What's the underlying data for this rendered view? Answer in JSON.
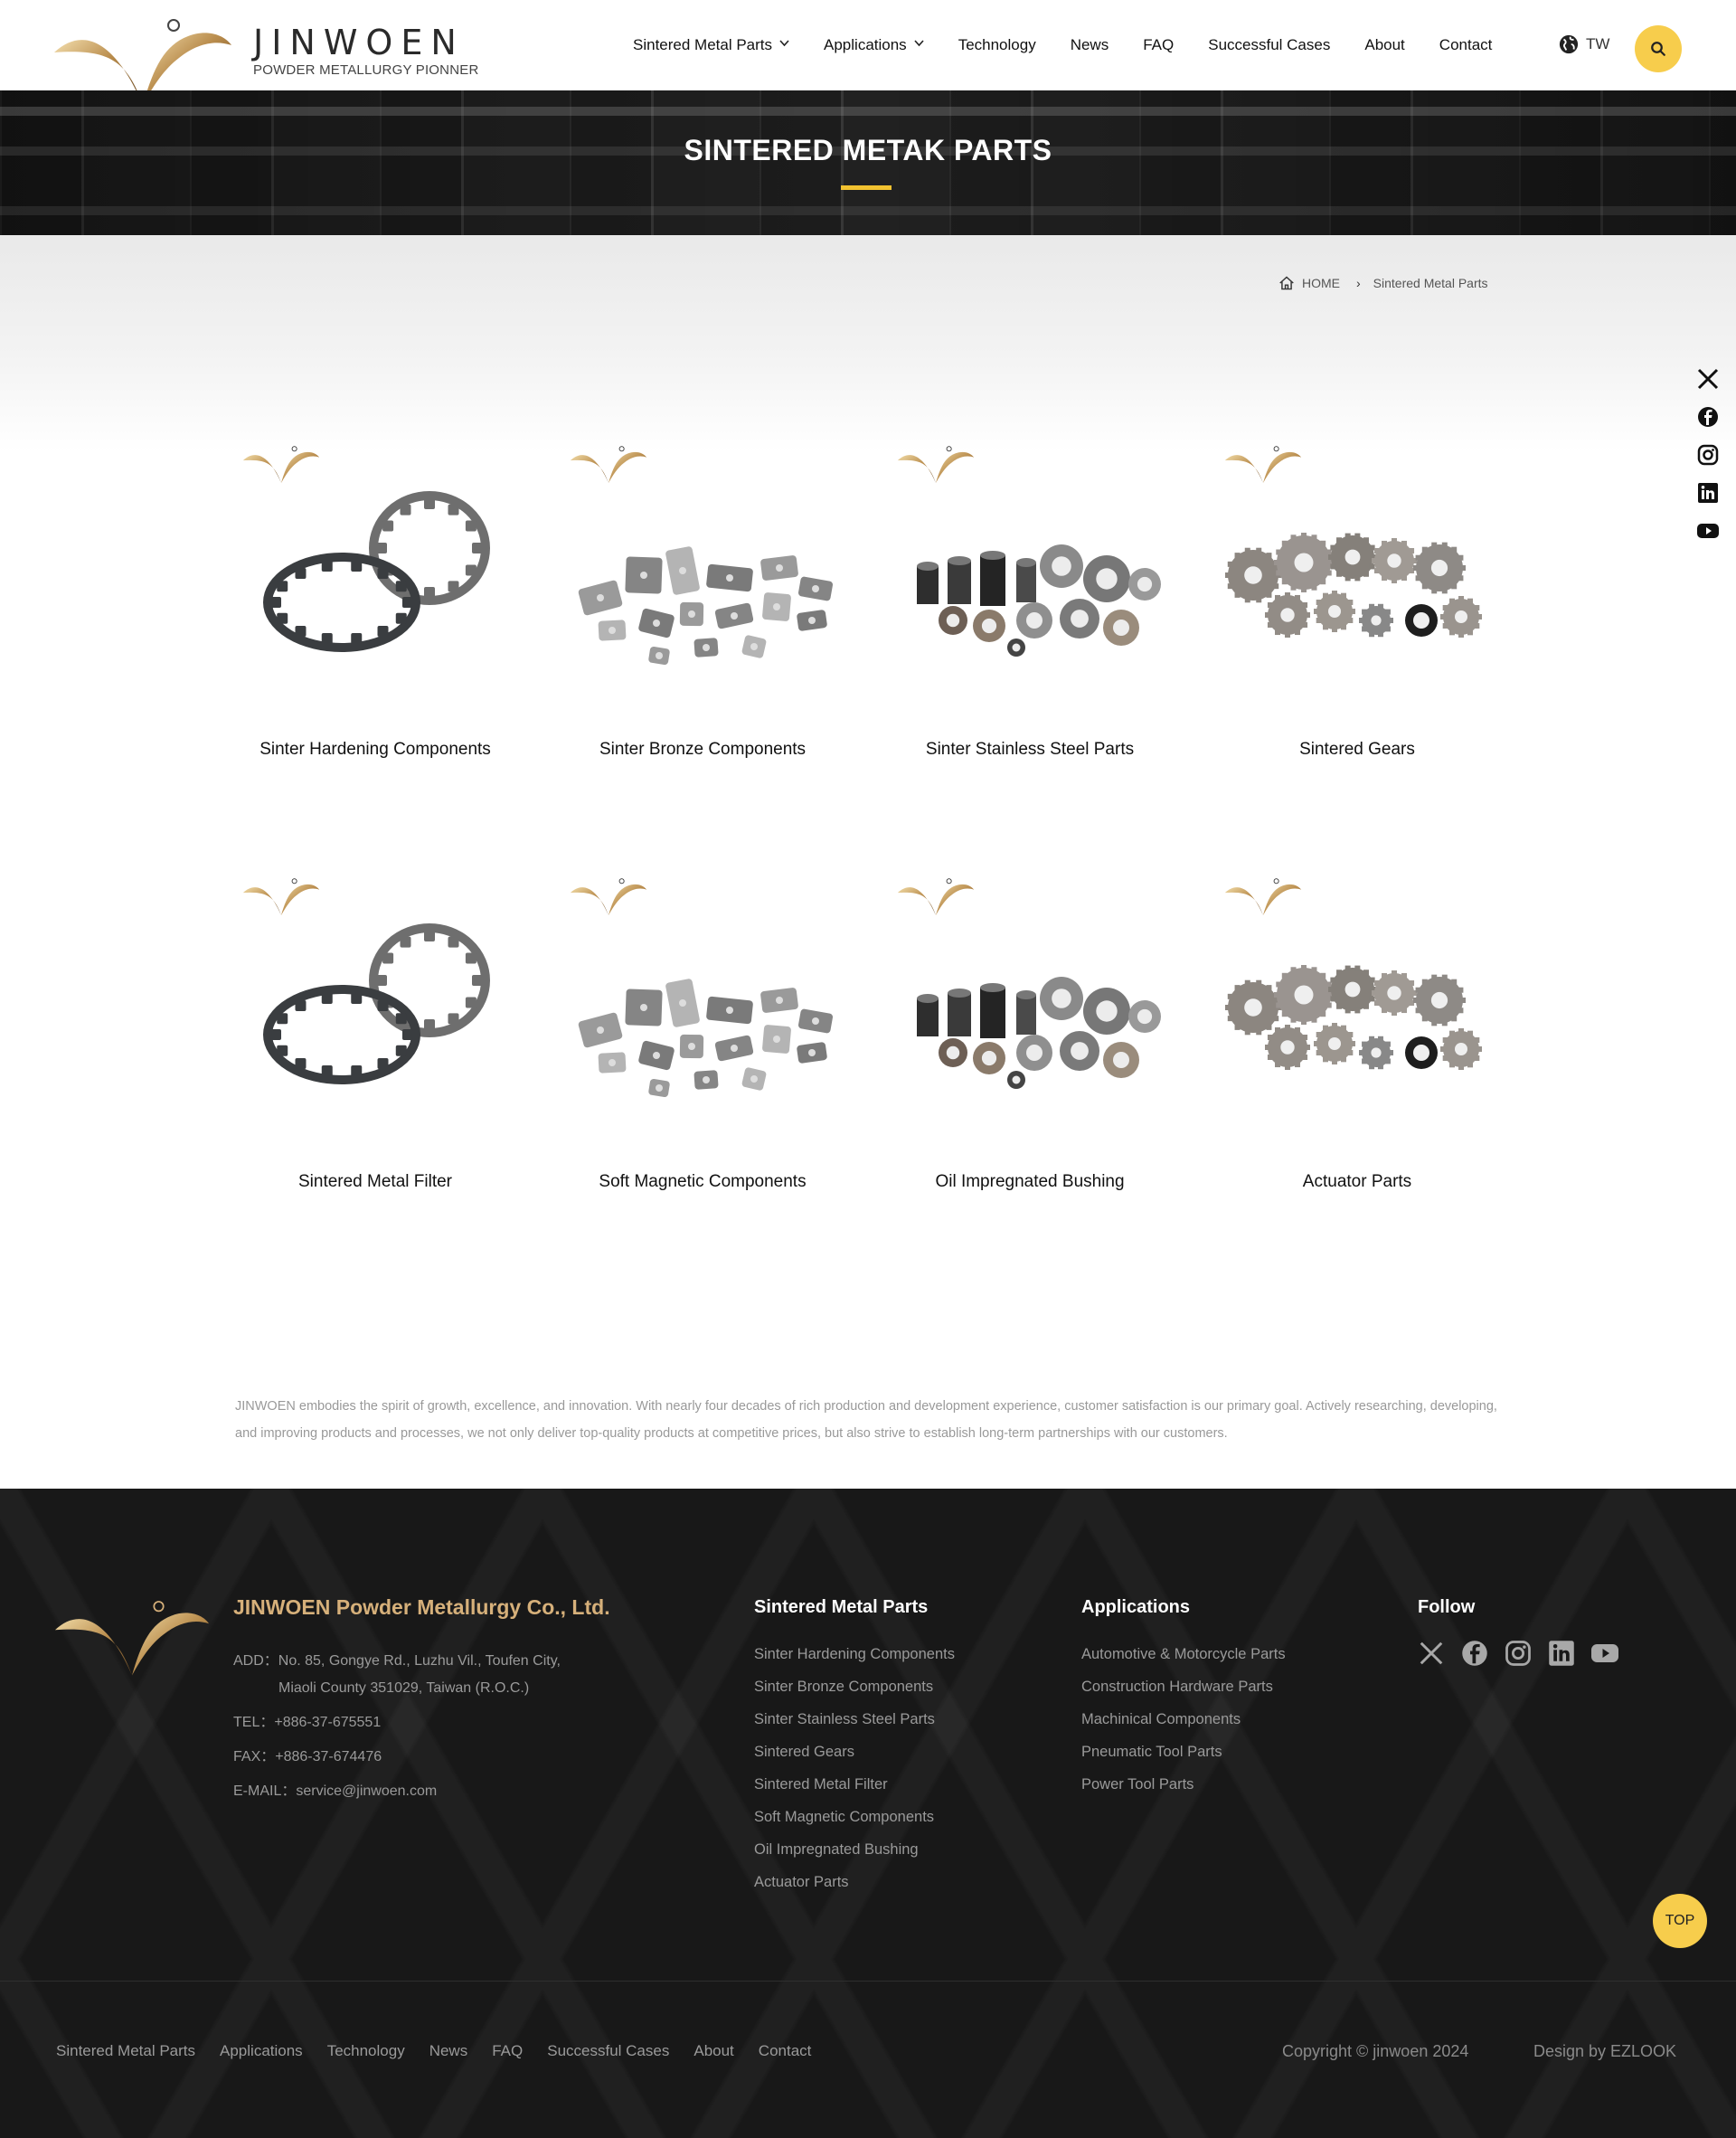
{
  "header": {
    "logo_name": "JINWOEN",
    "logo_sub": "POWDER METALLURGY PIONNER",
    "nav": [
      {
        "label": "Sintered Metal Parts",
        "dropdown": true
      },
      {
        "label": "Applications",
        "dropdown": true
      },
      {
        "label": "Technology",
        "dropdown": false
      },
      {
        "label": "News",
        "dropdown": false
      },
      {
        "label": "FAQ",
        "dropdown": false
      },
      {
        "label": "Successful Cases",
        "dropdown": false
      },
      {
        "label": "About",
        "dropdown": false
      },
      {
        "label": "Contact",
        "dropdown": false
      }
    ],
    "lang": "TW",
    "lang_icon": "globe-icon",
    "search_icon": "search-icon"
  },
  "banner": {
    "title": "SINTERED METAK PARTS"
  },
  "breadcrumb": {
    "home": "HOME",
    "current": "Sintered Metal Parts"
  },
  "side_social": [
    "x-icon",
    "facebook-icon",
    "instagram-icon",
    "linkedin-icon",
    "youtube-icon"
  ],
  "products": [
    {
      "label": "Sinter Hardening Components",
      "image": "ring-parts"
    },
    {
      "label": "Sinter Bronze Components",
      "image": "mixed-parts"
    },
    {
      "label": "Sinter Stainless Steel Parts",
      "image": "bushing-parts"
    },
    {
      "label": "Sintered Gears",
      "image": "gear-parts"
    },
    {
      "label": "Sintered Metal Filter",
      "image": "ring-parts"
    },
    {
      "label": "Soft Magnetic Components",
      "image": "mixed-parts"
    },
    {
      "label": "Oil Impregnated Bushing",
      "image": "bushing-parts"
    },
    {
      "label": "Actuator Parts",
      "image": "gear-parts"
    }
  ],
  "intro": "JINWOEN embodies the spirit of growth, excellence, and innovation. With nearly four decades of rich production and development experience, customer satisfaction is our primary goal. Actively researching, developing, and improving products and processes, we not only deliver top-quality products at competitive prices, but also strive to establish long-term partnerships with our customers.",
  "footer": {
    "company": "JINWOEN Powder Metallurgy Co., Ltd.",
    "address_1": "ADD：No. 85, Gongye Rd., Luzhu Vil., Toufen City,",
    "address_2": "Miaoli County 351029, Taiwan (R.O.C.)",
    "tel": "TEL：+886-37-675551",
    "fax": "FAX：+886-37-674476",
    "email": "E-MAIL：service@jinwoen.com",
    "col_parts_head": "Sintered Metal Parts",
    "col_parts": [
      "Sinter Hardening Components",
      "Sinter Bronze Components",
      "Sinter Stainless Steel Parts",
      "Sintered Gears",
      "Sintered Metal Filter",
      "Soft Magnetic Components",
      "Oil Impregnated Bushing",
      "Actuator Parts"
    ],
    "col_apps_head": "Applications",
    "col_apps": [
      "Automotive & Motorcycle Parts",
      "Construction Hardware Parts",
      "Machinical Components",
      "Pneumatic Tool Parts",
      "Power Tool Parts"
    ],
    "follow_head": "Follow",
    "follow_icons": [
      "x-icon",
      "facebook-icon",
      "instagram-icon",
      "linkedin-icon",
      "youtube-icon"
    ],
    "top_label": "TOP",
    "bottom_nav": [
      "Sintered Metal Parts",
      "Applications",
      "Technology",
      "News",
      "FAQ",
      "Successful Cases",
      "About",
      "Contact"
    ],
    "copyright": "Copyright © jinwoen 2024",
    "design": "Design by EZLOOK"
  },
  "colors": {
    "accent_yellow": "#f7cd4c",
    "banner_underline": "#f2c230",
    "footer_bg": "#181818",
    "footer_company": "#d6b07a",
    "logo_gold": "#b98c4c"
  }
}
